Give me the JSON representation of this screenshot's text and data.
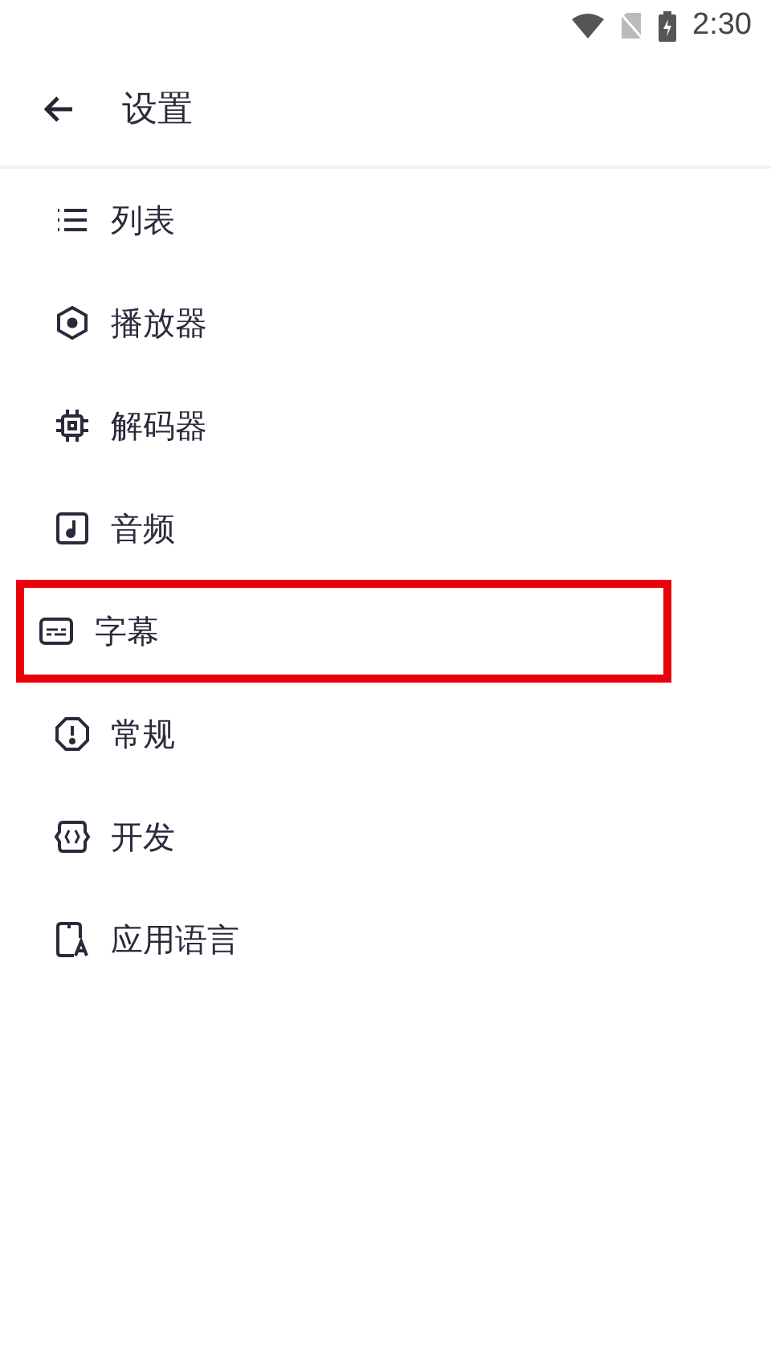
{
  "status_bar": {
    "time": "2:30"
  },
  "header": {
    "title": "设置"
  },
  "items": [
    {
      "label": "列表",
      "highlighted": false
    },
    {
      "label": "播放器",
      "highlighted": false
    },
    {
      "label": "解码器",
      "highlighted": false
    },
    {
      "label": "音频",
      "highlighted": false
    },
    {
      "label": "字幕",
      "highlighted": true
    },
    {
      "label": "常规",
      "highlighted": false
    },
    {
      "label": "开发",
      "highlighted": false
    },
    {
      "label": "应用语言",
      "highlighted": false
    }
  ]
}
